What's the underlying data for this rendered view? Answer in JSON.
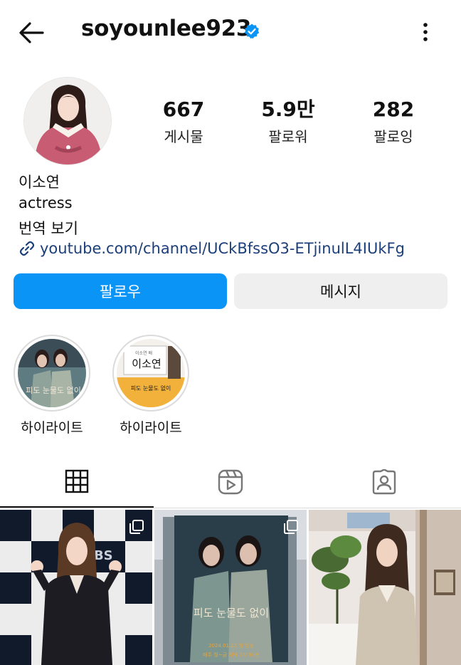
{
  "header": {
    "username": "soyounlee923",
    "back_icon": "arrow-left-icon",
    "verified_icon": "verified-badge-icon",
    "more_icon": "more-vertical-icon"
  },
  "stats": {
    "posts_count": "667",
    "posts_label": "게시물",
    "followers_count": "5.9만",
    "followers_label": "팔로워",
    "following_count": "282",
    "following_label": "팔로잉"
  },
  "bio": {
    "name": "이소연",
    "text": "actress",
    "translate": "번역 보기",
    "link": "youtube.com/channel/UCkBfssO3-ETjinulL4IUkFg",
    "link_icon": "link-icon"
  },
  "actions": {
    "follow_label": "팔로우",
    "message_label": "메시지"
  },
  "highlights": [
    {
      "label": "하이라이트"
    },
    {
      "label": "하이라이트"
    }
  ],
  "highlight_texts": {
    "name_card": "이소연",
    "card_small": "이소연 배",
    "card_title": "피도 눈물도 없이"
  },
  "tabs": [
    {
      "icon": "grid-icon",
      "active": true
    },
    {
      "icon": "reels-icon",
      "active": false
    },
    {
      "icon": "tagged-icon",
      "active": false
    }
  ],
  "posts": [
    {
      "overlay_text": "KBS",
      "multi": true
    },
    {
      "overlay_text": "피도 눈물도 없이",
      "caption_line1": "2024.01.22 첫 방송",
      "caption_line2": "매주 월~금 저녁 7시 50분",
      "multi": true
    },
    {
      "overlay_text": "",
      "multi": false
    }
  ],
  "colors": {
    "primary_button": "#0a95f6",
    "secondary_button": "#efefef",
    "link": "#1b3f7a",
    "verified": "#0a95f6"
  }
}
